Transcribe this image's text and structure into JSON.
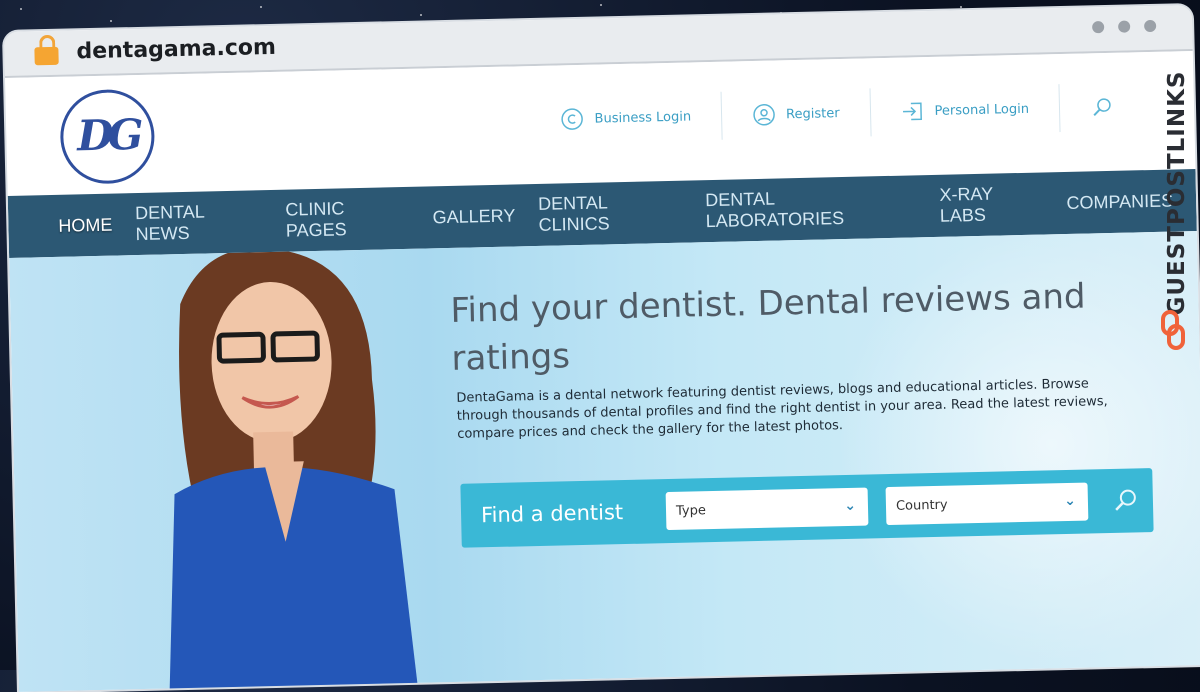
{
  "browser": {
    "url": "dentagama.com"
  },
  "site": {
    "logo_text": "DG",
    "top_links": [
      {
        "label": "Business Login",
        "icon": "copyright-circle-icon"
      },
      {
        "label": "Register",
        "icon": "user-circle-icon"
      },
      {
        "label": "Personal Login",
        "icon": "login-arrow-icon"
      }
    ],
    "nav": [
      {
        "label": "HOME",
        "active": true
      },
      {
        "label": "DENTAL NEWS",
        "active": false
      },
      {
        "label": "CLINIC PAGES",
        "active": false
      },
      {
        "label": "GALLERY",
        "active": false
      },
      {
        "label": "DENTAL CLINICS",
        "active": false
      },
      {
        "label": "DENTAL LABORATORIES",
        "active": false
      },
      {
        "label": "X-RAY LABS",
        "active": false
      },
      {
        "label": "COMPANIES",
        "active": false
      }
    ],
    "hero": {
      "headline": "Find your dentist. Dental reviews and ratings",
      "description": "DentaGama is a dental network featuring dentist reviews, blogs and educational articles. Browse through thousands of dental profiles and find the right dentist in your area. Read the latest reviews, compare prices and check the gallery for the latest photos."
    },
    "finder": {
      "label": "Find a dentist",
      "type_value": "Type",
      "country_value": "Country"
    }
  },
  "watermark": "GUESTPOSTLINKS",
  "colors": {
    "accent": "#3ab8d6",
    "nav_bg": "#2c5874",
    "link": "#3a9ec4"
  }
}
